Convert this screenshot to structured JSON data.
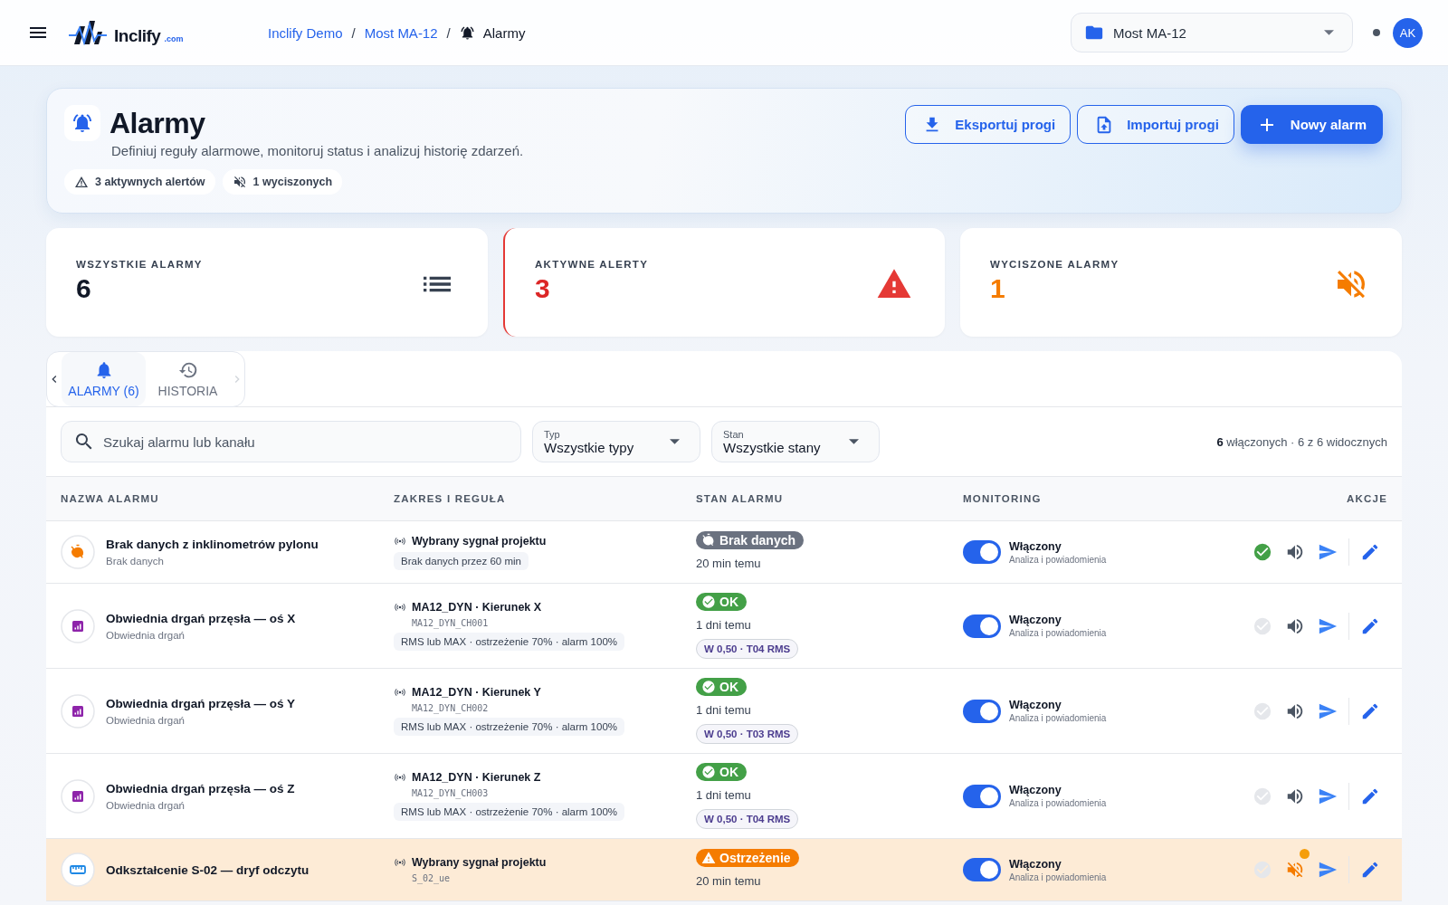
{
  "header": {
    "logo": {
      "name": "Inclify",
      "suffix": ".com"
    },
    "breadcrumbs": [
      {
        "label": "Inclify Demo",
        "kind": "link"
      },
      {
        "label": "Most MA-12",
        "kind": "link"
      },
      {
        "label": "Alarmy",
        "kind": "current"
      }
    ],
    "breadcrumb_separator": "/",
    "project_select": {
      "value": "Most MA-12"
    },
    "avatar": "AK"
  },
  "hero": {
    "title": "Alarmy",
    "description": "Definiuj reguły alarmowe, monitoruj status i analizuj historię zdarzeń.",
    "chips": [
      {
        "kind": "alert",
        "label": "3 aktywnych alertów"
      },
      {
        "kind": "muted",
        "label": "1 wyciszonych"
      }
    ],
    "buttons": [
      {
        "kind": "export",
        "label": "Eksportuj progi"
      },
      {
        "kind": "import",
        "label": "Importuj progi"
      },
      {
        "kind": "new",
        "label": "Nowy alarm"
      }
    ]
  },
  "stats": [
    {
      "kind": "all",
      "label": "WSZYSTKIE ALARMY",
      "value": "6"
    },
    {
      "kind": "active",
      "label": "AKTYWNE ALERTY",
      "value": "3"
    },
    {
      "kind": "muted",
      "label": "WYCISZONE ALARMY",
      "value": "1"
    }
  ],
  "tabs": [
    {
      "kind": "bell",
      "label": "ALARMY (6)",
      "selected": true
    },
    {
      "kind": "history",
      "label": "HISTORIA",
      "selected": false
    }
  ],
  "filters": {
    "search": {
      "placeholder": "Szukaj alarmu lub kanału"
    },
    "selects": [
      {
        "label": "Typ",
        "value": "Wszystkie typy"
      },
      {
        "label": "Stan",
        "value": "Wszystkie stany"
      }
    ],
    "summary": "**6** włączonych · 6 z 6 widocznych"
  },
  "table": {
    "columns": [
      "NAZWA ALARMU",
      "ZAKRES I REGUŁA",
      "STAN ALARMU",
      "MONITORING",
      "AKCJE"
    ],
    "rows": [
      {
        "kind": "no_data",
        "name": "Brak danych z inklinometrów pylonu",
        "type": "Brak danych",
        "source": "Wybrany sygnał projektu",
        "rule": "Brak danych przez 60 min",
        "status": {
          "kind": "no_data",
          "label": "Brak danych"
        },
        "time": "20 min temu",
        "monitoring": {
          "on": true,
          "label": "Włączony",
          "sub": "Analiza i powiadomienia"
        },
        "acknowledged": true,
        "muted": false
      },
      {
        "kind": "envelope",
        "name": "Obwiednia drgań przęsła — oś X",
        "type": "Obwiednia drgań",
        "source": "MA12_DYN · Kierunek X",
        "code": "MA12_DYN_CH001",
        "rule": "RMS lub MAX · ostrzeżenie 70% · alarm 100%",
        "status": {
          "kind": "ok",
          "label": "OK"
        },
        "time": "1 dni temu",
        "threshold": "W 0,50 · T04 RMS",
        "monitoring": {
          "on": true,
          "label": "Włączony",
          "sub": "Analiza i powiadomienia"
        },
        "acknowledged": false,
        "muted": false
      },
      {
        "kind": "envelope",
        "name": "Obwiednia drgań przęsła — oś Y",
        "type": "Obwiednia drgań",
        "source": "MA12_DYN · Kierunek Y",
        "code": "MA12_DYN_CH002",
        "rule": "RMS lub MAX · ostrzeżenie 70% · alarm 100%",
        "status": {
          "kind": "ok",
          "label": "OK"
        },
        "time": "1 dni temu",
        "threshold": "W 0,50 · T03 RMS",
        "monitoring": {
          "on": true,
          "label": "Włączony",
          "sub": "Analiza i powiadomienia"
        },
        "acknowledged": false,
        "muted": false
      },
      {
        "kind": "envelope",
        "name": "Obwiednia drgań przęsła — oś Z",
        "type": "Obwiednia drgań",
        "source": "MA12_DYN · Kierunek Z",
        "code": "MA12_DYN_CH003",
        "rule": "RMS lub MAX · ostrzeżenie 70% · alarm 100%",
        "status": {
          "kind": "ok",
          "label": "OK"
        },
        "time": "1 dni temu",
        "threshold": "W 0,50 · T04 RMS",
        "monitoring": {
          "on": true,
          "label": "Włączony",
          "sub": "Analiza i powiadomienia"
        },
        "acknowledged": false,
        "muted": false
      },
      {
        "kind": "strain",
        "name": "Odkształcenie S-02 — dryf odczytu",
        "source": "Wybrany sygnał projektu",
        "code": "S_02_ue",
        "status": {
          "kind": "warning",
          "label": "Ostrzeżenie"
        },
        "time": "20 min temu",
        "monitoring": {
          "on": true,
          "label": "Włączony",
          "sub": "Analiza i powiadomienia"
        },
        "acknowledged": false,
        "muted": true
      }
    ]
  }
}
